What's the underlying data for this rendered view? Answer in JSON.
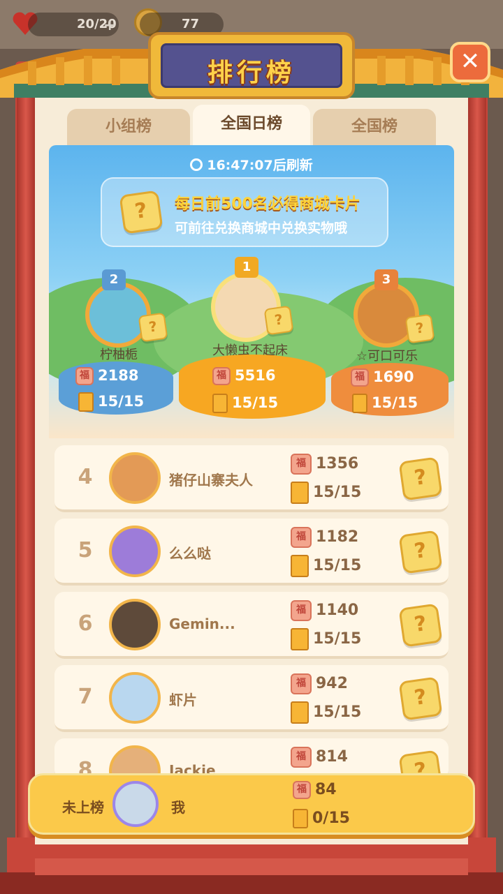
{
  "hud": {
    "lives": "20/20",
    "coins": "77"
  },
  "title": "排行榜",
  "close_label": "✕",
  "tabs": [
    {
      "label": "小组榜",
      "active": false
    },
    {
      "label": "全国日榜",
      "active": true
    },
    {
      "label": "全国榜",
      "active": false
    }
  ],
  "refresh": "16:47:07后刷新",
  "banner": {
    "line1": "每日前500名必得商城卡片",
    "line2": "可前往兑换商城中兑换实物哦",
    "card_glyph": "?"
  },
  "podium": [
    {
      "rank": "2",
      "name": "柠柚栀",
      "score": "2188",
      "cards": "15/15",
      "color": "#5aa6de"
    },
    {
      "rank": "1",
      "name": "大懒虫不起床",
      "score": "5516",
      "cards": "15/15",
      "color": "#f6a823"
    },
    {
      "rank": "3",
      "name": "☆可口可乐",
      "score": "1690",
      "cards": "15/15",
      "color": "#f1913f"
    }
  ],
  "rows": [
    {
      "rank": "4",
      "name": "猪仔山寨夫人",
      "score": "1356",
      "cards": "15/15"
    },
    {
      "rank": "5",
      "name": "么么哒",
      "score": "1182",
      "cards": "15/15"
    },
    {
      "rank": "6",
      "name": "Gemin...",
      "score": "1140",
      "cards": "15/15"
    },
    {
      "rank": "7",
      "name": "虾片",
      "score": "942",
      "cards": "15/15"
    },
    {
      "rank": "8",
      "name": "Jackie",
      "score": "814",
      "cards": ""
    }
  ],
  "me": {
    "status": "未上榜",
    "name": "我",
    "score": "84",
    "cards": "0/15"
  },
  "icons": {
    "fu": "福",
    "question": "?"
  }
}
